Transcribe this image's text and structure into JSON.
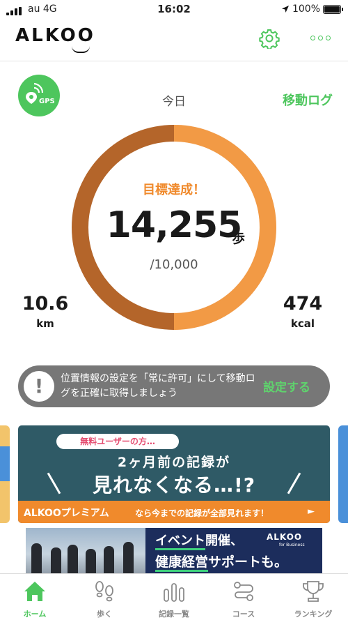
{
  "status_bar": {
    "carrier": "au 4G",
    "time": "16:02",
    "battery": "100%",
    "battery_level": 1.0
  },
  "header": {
    "logo": "ALKOO",
    "settings_icon": "gear-icon",
    "more_icon": "more-icon"
  },
  "summary": {
    "gps_label": "GPS",
    "period_label": "今日",
    "move_log_label": "移動ログ",
    "goal_message": "目標達成！",
    "steps": "14,255",
    "steps_unit": "歩",
    "target": "/10,000",
    "progress": 1.0,
    "distance_value": "10.6",
    "distance_unit": "km",
    "calories_value": "474",
    "calories_unit": "kcal",
    "ring_colors": {
      "left": "#b4652a",
      "right": "#f29a45"
    }
  },
  "notice": {
    "icon": "exclamation-icon",
    "text": "位置情報の設定を「常に許可」にして移動ログを正確に取得しましょう",
    "action_label": "設定する"
  },
  "banner": {
    "pill": "無料ユーザーの方…",
    "line1": "2ヶ月前の記録が",
    "line2": "見れなくなる…!?",
    "strip_brand": "ALKOOプレミアム",
    "strip_text": "なら今までの記録が全部見れます！",
    "strip_arrow": "►"
  },
  "ad": {
    "title1_highlight": "イベント",
    "title1_rest": "開催、",
    "title2_highlight": "健康経営",
    "title2_rest": "サポートも。",
    "brand": "ALKOO",
    "brand_sub": "for Business"
  },
  "tabs": [
    {
      "label": "ホーム",
      "icon": "home-icon",
      "active": true
    },
    {
      "label": "歩く",
      "icon": "footprints-icon",
      "active": false
    },
    {
      "label": "記録一覧",
      "icon": "bar-chart-icon",
      "active": false
    },
    {
      "label": "コース",
      "icon": "route-icon",
      "active": false
    },
    {
      "label": "ランキング",
      "icon": "trophy-icon",
      "active": false
    }
  ],
  "colors": {
    "accent_green": "#4dc65d",
    "orange": "#f08a2c",
    "banner_bg": "#2f5a66",
    "ad_bg": "#1c2d5c"
  }
}
